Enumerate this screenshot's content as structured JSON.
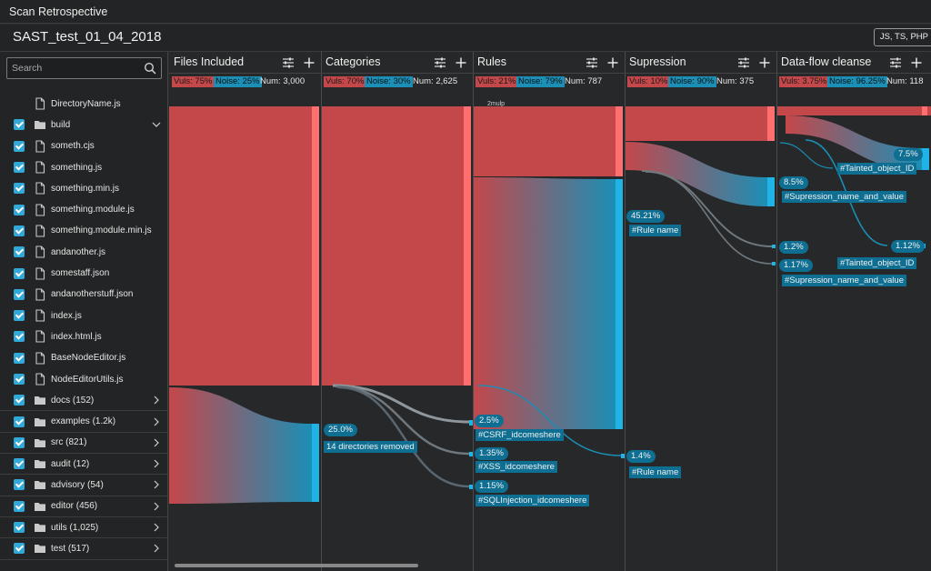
{
  "app": {
    "title": "Scan Retrospective"
  },
  "header": {
    "scan_name": "SAST_test_01_04_2018",
    "languages": "JS, TS, PHP"
  },
  "search": {
    "placeholder": "Search"
  },
  "files": [
    {
      "label": "DirectoryName.js",
      "type": "file",
      "checked": false,
      "expandable": false
    },
    {
      "label": "build",
      "type": "folder",
      "checked": true,
      "expandable": true,
      "expanded": true
    },
    {
      "label": "someth.cjs",
      "type": "file",
      "checked": true,
      "expandable": false
    },
    {
      "label": "something.js",
      "type": "file",
      "checked": true,
      "expandable": false
    },
    {
      "label": "something.min.js",
      "type": "file",
      "checked": true,
      "expandable": false
    },
    {
      "label": "something.module.js",
      "type": "file",
      "checked": true,
      "expandable": false
    },
    {
      "label": "something.module.min.js",
      "type": "file",
      "checked": true,
      "expandable": false
    },
    {
      "label": "andanother.js",
      "type": "file",
      "checked": true,
      "expandable": false
    },
    {
      "label": "somestaff.json",
      "type": "file",
      "checked": true,
      "expandable": false
    },
    {
      "label": "andanotherstuff.json",
      "type": "file",
      "checked": true,
      "expandable": false
    },
    {
      "label": "index.js",
      "type": "file",
      "checked": true,
      "expandable": false
    },
    {
      "label": "index.html.js",
      "type": "file",
      "checked": true,
      "expandable": false
    },
    {
      "label": "BaseNodeEditor.js",
      "type": "file",
      "checked": true,
      "expandable": false
    },
    {
      "label": "NodeEditorUtils.js",
      "type": "file",
      "checked": true,
      "expandable": false
    },
    {
      "label": "docs (152)",
      "type": "folder",
      "checked": true,
      "expandable": true
    },
    {
      "label": "examples (1.2k)",
      "type": "folder",
      "checked": true,
      "expandable": true
    },
    {
      "label": "src (821)",
      "type": "folder",
      "checked": true,
      "expandable": true
    },
    {
      "label": "audit (12)",
      "type": "folder",
      "checked": true,
      "expandable": true
    },
    {
      "label": "advisory (54)",
      "type": "folder",
      "checked": true,
      "expandable": true
    },
    {
      "label": "editor (456)",
      "type": "folder",
      "checked": true,
      "expandable": true
    },
    {
      "label": "utils (1,025)",
      "type": "folder",
      "checked": true,
      "expandable": true
    },
    {
      "label": "test (517)",
      "type": "folder",
      "checked": true,
      "expandable": true
    }
  ],
  "columns": [
    {
      "title": "Files Included",
      "vuls": "Vuls: 75%",
      "noise": "Noise: 25%",
      "num": "Num: 3,000"
    },
    {
      "title": "Categories",
      "vuls": "Vuls: 70%",
      "noise": "Noise: 30%",
      "num": "Num: 2,625"
    },
    {
      "title": "Rules",
      "vuls": "Vuls: 21%",
      "noise": "Noise: 79%",
      "num": "Num: 787"
    },
    {
      "title": "Supression",
      "vuls": "Vuls: 10%",
      "noise": "Noise: 90%",
      "num": "Num: 375"
    },
    {
      "title": "Data-flow cleanse",
      "vuls": "Vuls: 3.75%",
      "noise": "Noise: 96.25%",
      "num": "Num: 118"
    }
  ],
  "sankey_labels": {
    "categories_pct": "25.0%",
    "categories_tag": "14 directories removed",
    "rules_big_pct": "45.21%",
    "rules_big_tag": "#Rule name",
    "rules_small_pct": "1.4%",
    "rules_small_tag": "#Rule name",
    "csrf_pct": "2.5%",
    "csrf_tag": "#CSRF_idcomeshere",
    "xss_pct": "1.35%",
    "xss_tag": "#XSS_idcomeshere",
    "sqli_pct": "1.15%",
    "sqli_tag": "#SQLInjection_idcomeshere",
    "supp_a_pct": "8.5%",
    "supp_a_tag": "#Supression_name_and_value",
    "supp_b_pct": "1.2%",
    "supp_c_pct": "1.17%",
    "supp_c_tag": "#Supression_name_and_value",
    "taint_a_pct": "7.5%",
    "taint_a_tag": "#Tainted_object_ID",
    "taint_b_pct": "1.12%",
    "taint_b_tag": "#Tainted_object_ID",
    "tiny": "2mulp"
  },
  "colors": {
    "vuln": "#c4474a",
    "noise": "#1b8fb6",
    "bar_vuln": "#ff6f6f",
    "bar_noise": "#1fb3e6"
  }
}
